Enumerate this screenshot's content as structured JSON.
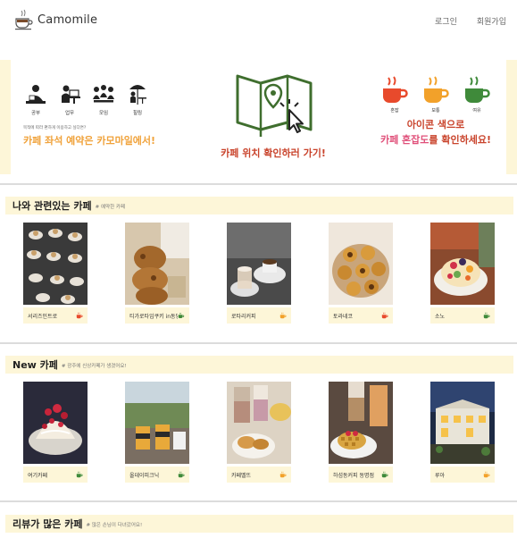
{
  "header": {
    "app_name": "Camomile",
    "nav": {
      "login": "로그인",
      "signup": "회원가입"
    }
  },
  "banner": {
    "purposes": [
      "공부",
      "업무",
      "모임",
      "힐링"
    ],
    "left_sub": "목적에 따라 편하게 이용하고 싶다면?",
    "left_title": "카페 좌석 예약은 카모마일에서!",
    "center_title": "카페 위치 확인하러 가기!",
    "cups": [
      {
        "label": "혼잡",
        "color": "#e84a2c"
      },
      {
        "label": "보통",
        "color": "#f2a12a"
      },
      {
        "label": "여유",
        "color": "#3f8a3a"
      }
    ],
    "right_line1": "아이콘 색으로",
    "right_line2_highlight": "카페 혼잡도",
    "right_line2_rest": "를 확인하세요!"
  },
  "sections": [
    {
      "title": "나와 관련있는 카페",
      "subtitle": "# 예약한 카페",
      "cafes": [
        {
          "name": "서리즈인트로",
          "status": "혼잡"
        },
        {
          "name": "티가로타임쿠키 in동명",
          "status": "여유"
        },
        {
          "name": "로타리커피",
          "status": "보통"
        },
        {
          "name": "토라네코",
          "status": "혼잡"
        },
        {
          "name": "소노",
          "status": "여유"
        }
      ]
    },
    {
      "title": "New 카페",
      "subtitle": "# 광주에 신상카페가 생겼어요!",
      "cafes": [
        {
          "name": "여기카페",
          "status": "여유"
        },
        {
          "name": "올데이피크닉",
          "status": "여유"
        },
        {
          "name": "카페벨뜨",
          "status": "보통"
        },
        {
          "name": "하섬동커피 동명점",
          "status": "여유"
        },
        {
          "name": "루아",
          "status": "보통"
        }
      ]
    },
    {
      "title": "리뷰가 많은 카페",
      "subtitle": "# 많은 손님이 다녀갔어요!",
      "cafes": []
    }
  ],
  "colors": {
    "accent_yellow": "#fdf6d8",
    "busy": "#e84a2c",
    "normal": "#f2a12a",
    "free": "#3f8a3a"
  }
}
